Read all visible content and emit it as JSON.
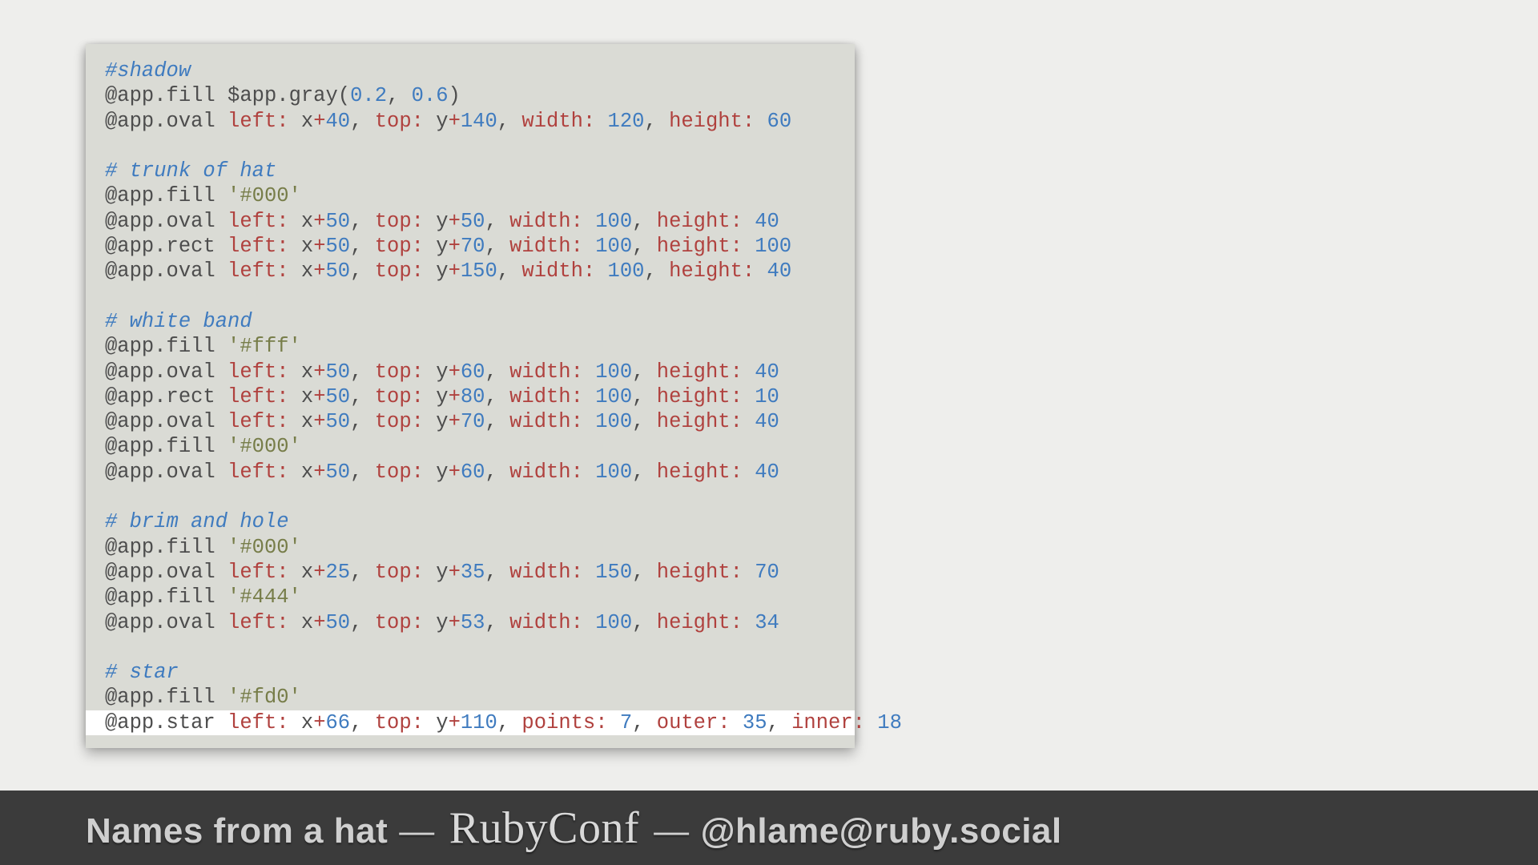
{
  "footer": {
    "left": "Names from a hat",
    "dash1": "—",
    "brand": "RubyConf",
    "dash2": "—",
    "handle": "@hlame@ruby.social"
  },
  "code": {
    "lines": [
      {
        "t": "comment",
        "text": "#shadow"
      },
      {
        "t": "fill_method",
        "method": "fill",
        "arg_prefix": "$app",
        "arg_method": "gray",
        "args_nums": [
          "0.2",
          "0.6"
        ]
      },
      {
        "t": "shape",
        "method": "oval",
        "params": [
          {
            "key": "left",
            "var": "x",
            "op": "+",
            "num": "40"
          },
          {
            "key": "top",
            "var": "y",
            "op": "+",
            "num": "140"
          },
          {
            "key": "width",
            "num": "120"
          },
          {
            "key": "height",
            "num": "60"
          }
        ]
      },
      {
        "t": "blank"
      },
      {
        "t": "comment",
        "text": "# trunk of hat"
      },
      {
        "t": "fill_str",
        "str": "'#000'"
      },
      {
        "t": "shape",
        "method": "oval",
        "params": [
          {
            "key": "left",
            "var": "x",
            "op": "+",
            "num": "50"
          },
          {
            "key": "top",
            "var": "y",
            "op": "+",
            "num": "50"
          },
          {
            "key": "width",
            "num": "100"
          },
          {
            "key": "height",
            "num": "40"
          }
        ]
      },
      {
        "t": "shape",
        "method": "rect",
        "params": [
          {
            "key": "left",
            "var": "x",
            "op": "+",
            "num": "50"
          },
          {
            "key": "top",
            "var": "y",
            "op": "+",
            "num": "70"
          },
          {
            "key": "width",
            "num": "100"
          },
          {
            "key": "height",
            "num": "100"
          }
        ]
      },
      {
        "t": "shape",
        "method": "oval",
        "params": [
          {
            "key": "left",
            "var": "x",
            "op": "+",
            "num": "50"
          },
          {
            "key": "top",
            "var": "y",
            "op": "+",
            "num": "150"
          },
          {
            "key": "width",
            "num": "100"
          },
          {
            "key": "height",
            "num": "40"
          }
        ]
      },
      {
        "t": "blank"
      },
      {
        "t": "comment",
        "text": "# white band"
      },
      {
        "t": "fill_str",
        "str": "'#fff'"
      },
      {
        "t": "shape",
        "method": "oval",
        "params": [
          {
            "key": "left",
            "var": "x",
            "op": "+",
            "num": "50"
          },
          {
            "key": "top",
            "var": "y",
            "op": "+",
            "num": "60"
          },
          {
            "key": "width",
            "num": "100"
          },
          {
            "key": "height",
            "num": "40"
          }
        ]
      },
      {
        "t": "shape",
        "method": "rect",
        "params": [
          {
            "key": "left",
            "var": "x",
            "op": "+",
            "num": "50"
          },
          {
            "key": "top",
            "var": "y",
            "op": "+",
            "num": "80"
          },
          {
            "key": "width",
            "num": "100"
          },
          {
            "key": "height",
            "num": "10"
          }
        ]
      },
      {
        "t": "shape",
        "method": "oval",
        "params": [
          {
            "key": "left",
            "var": "x",
            "op": "+",
            "num": "50"
          },
          {
            "key": "top",
            "var": "y",
            "op": "+",
            "num": "70"
          },
          {
            "key": "width",
            "num": "100"
          },
          {
            "key": "height",
            "num": "40"
          }
        ]
      },
      {
        "t": "fill_str",
        "str": "'#000'"
      },
      {
        "t": "shape",
        "method": "oval",
        "params": [
          {
            "key": "left",
            "var": "x",
            "op": "+",
            "num": "50"
          },
          {
            "key": "top",
            "var": "y",
            "op": "+",
            "num": "60"
          },
          {
            "key": "width",
            "num": "100"
          },
          {
            "key": "height",
            "num": "40"
          }
        ]
      },
      {
        "t": "blank"
      },
      {
        "t": "comment",
        "text": "# brim and hole"
      },
      {
        "t": "fill_str",
        "str": "'#000'"
      },
      {
        "t": "shape",
        "method": "oval",
        "params": [
          {
            "key": "left",
            "var": "x",
            "op": "+",
            "num": "25"
          },
          {
            "key": "top",
            "var": "y",
            "op": "+",
            "num": "35"
          },
          {
            "key": "width",
            "num": "150"
          },
          {
            "key": "height",
            "num": "70"
          }
        ]
      },
      {
        "t": "fill_str",
        "str": "'#444'"
      },
      {
        "t": "shape",
        "method": "oval",
        "params": [
          {
            "key": "left",
            "var": "x",
            "op": "+",
            "num": "50"
          },
          {
            "key": "top",
            "var": "y",
            "op": "+",
            "num": "53"
          },
          {
            "key": "width",
            "num": "100"
          },
          {
            "key": "height",
            "num": "34"
          }
        ]
      },
      {
        "t": "blank"
      },
      {
        "t": "comment",
        "text": "# star"
      },
      {
        "t": "fill_str",
        "str": "'#fd0'"
      },
      {
        "t": "shape",
        "hilite": true,
        "method": "star",
        "params": [
          {
            "key": "left",
            "var": "x",
            "op": "+",
            "num": "66"
          },
          {
            "key": "top",
            "var": "y",
            "op": "+",
            "num": "110"
          },
          {
            "key": "points",
            "num": "7"
          },
          {
            "key": "outer",
            "num": "35"
          },
          {
            "key": "inner",
            "num": "18"
          }
        ]
      }
    ]
  }
}
